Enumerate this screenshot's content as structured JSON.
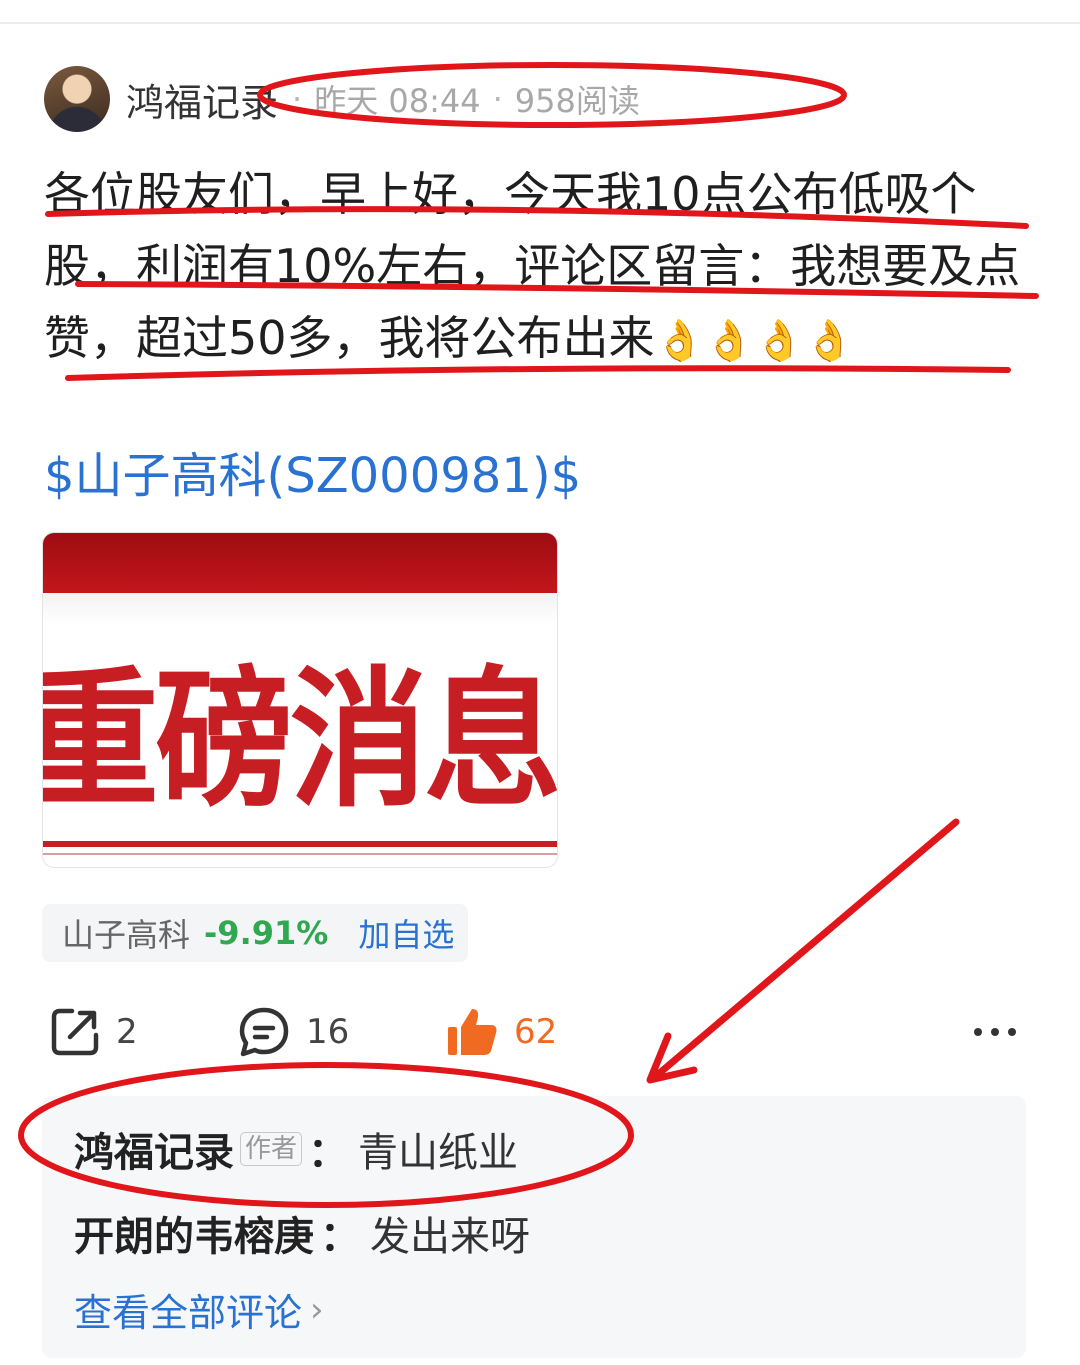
{
  "post": {
    "author": "鸿福记录",
    "time": "昨天 08:44",
    "reads": "958阅读",
    "body_text": "各位股友们，早上好，今天我10点公布低吸个股，利润有10%左右，评论区留言：我想要及点赞，超过50多，我将公布出来",
    "emojis": "👌👌👌👌",
    "stock_link": "$山子高科(SZ000981)$",
    "image_text": "重磅消息"
  },
  "stock_chip": {
    "name": "山子高科",
    "change": "-9.91%",
    "add_label": "加自选"
  },
  "actions": {
    "share_count": "2",
    "comment_count": "16",
    "like_count": "62"
  },
  "comments": {
    "items": [
      {
        "user": "鸿福记录",
        "tag": "作者",
        "text": "青山纸业"
      },
      {
        "user": "开朗的韦榕庚",
        "tag": "",
        "text": "发出来呀"
      }
    ],
    "view_all": "查看全部评论"
  },
  "colors": {
    "link_blue": "#2a72d2",
    "down_green": "#2fa84f",
    "like_orange": "#f06a22",
    "annotation_red": "#e0161b"
  }
}
